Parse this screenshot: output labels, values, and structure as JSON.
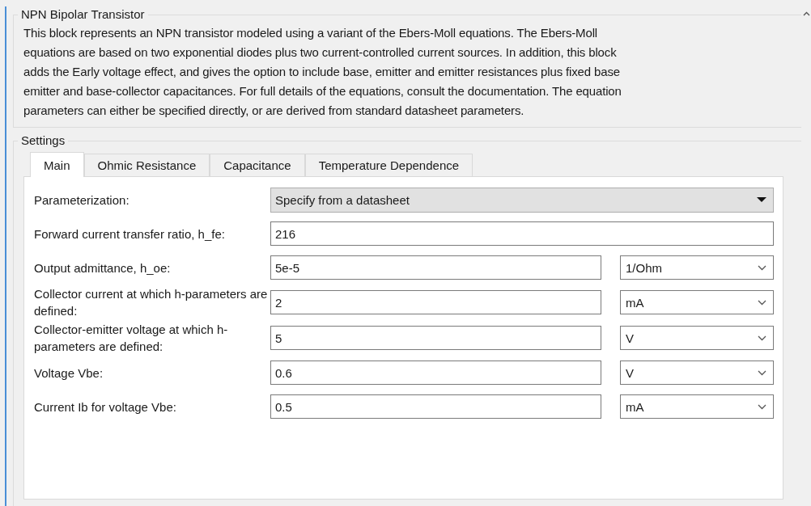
{
  "block": {
    "title": "NPN Bipolar Transistor",
    "description": [
      "This block represents an NPN transistor modeled using a variant of the Ebers-Moll equations. The Ebers-Moll",
      "equations are based on two exponential diodes plus two current-controlled current sources. In addition, this block",
      "adds the Early voltage effect, and gives the option to include base, emitter and emitter resistances plus fixed base",
      "emitter and base-collector capacitances. For full details of the equations, consult the documentation. The equation",
      "parameters can either be specified directly, or are derived from standard datasheet parameters."
    ]
  },
  "settings": {
    "title": "Settings",
    "tabs": [
      {
        "label": "Main",
        "selected": true
      },
      {
        "label": "Ohmic Resistance",
        "selected": false
      },
      {
        "label": "Capacitance",
        "selected": false
      },
      {
        "label": "Temperature Dependence",
        "selected": false
      }
    ],
    "parameters": [
      {
        "kind": "dropdown",
        "label": "Parameterization:",
        "value": "Specify from a datasheet"
      },
      {
        "kind": "field",
        "label": "Forward current transfer ratio, h_fe:",
        "value": "216"
      },
      {
        "kind": "unit-field",
        "label": "Output admittance, h_oe:",
        "value": "5e-5",
        "unit": "1/Ohm"
      },
      {
        "kind": "unit-field",
        "label": "Collector current at which h-parameters are defined:",
        "value": "2",
        "unit": "mA"
      },
      {
        "kind": "unit-field",
        "label": "Collector-emitter voltage at which h-parameters are defined:",
        "value": "5",
        "unit": "V"
      },
      {
        "kind": "unit-field",
        "label": "Voltage Vbe:",
        "value": "0.6",
        "unit": "V"
      },
      {
        "kind": "unit-field",
        "label": "Current Ib for voltage Vbe:",
        "value": "0.5",
        "unit": "mA"
      }
    ]
  }
}
